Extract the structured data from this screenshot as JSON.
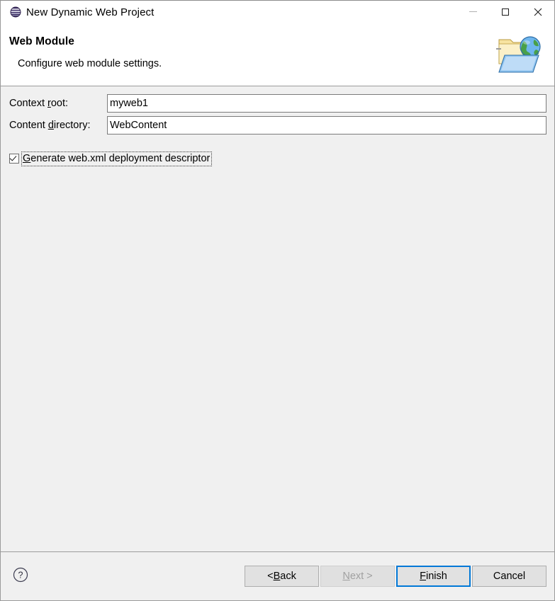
{
  "window": {
    "title": "New Dynamic Web Project",
    "icon": "eclipse-sphere-icon",
    "controls": {
      "minimize": "minimize-icon",
      "maximize": "maximize-icon",
      "close": "close-icon"
    }
  },
  "header": {
    "title": "Web Module",
    "description": "Configure web module settings.",
    "icon": "web-folder-globe-icon"
  },
  "form": {
    "context_root": {
      "label_pre": "Context ",
      "label_mnemonic": "r",
      "label_post": "oot:",
      "value": "myweb1"
    },
    "content_directory": {
      "label_pre": "Content ",
      "label_mnemonic": "d",
      "label_post": "irectory:",
      "value": "WebContent"
    },
    "generate_webxml": {
      "mnemonic": "G",
      "label_post": "enerate web.xml deployment descriptor",
      "checked": "checked"
    }
  },
  "footer": {
    "help_icon": "help-question-icon",
    "buttons": {
      "back": {
        "pre": "< ",
        "mnemonic": "B",
        "post": "ack"
      },
      "next": {
        "pre": "",
        "mnemonic": "N",
        "post": "ext >"
      },
      "finish": {
        "pre": "",
        "mnemonic": "F",
        "post": "inish"
      },
      "cancel": {
        "pre": "Cancel",
        "mnemonic": "",
        "post": ""
      }
    }
  },
  "colors": {
    "accent": "#0078d7",
    "dialog_bg": "#f0f0f0",
    "header_bg": "#ffffff",
    "button_bg": "#e1e1e1",
    "border": "#9b9b9b"
  }
}
